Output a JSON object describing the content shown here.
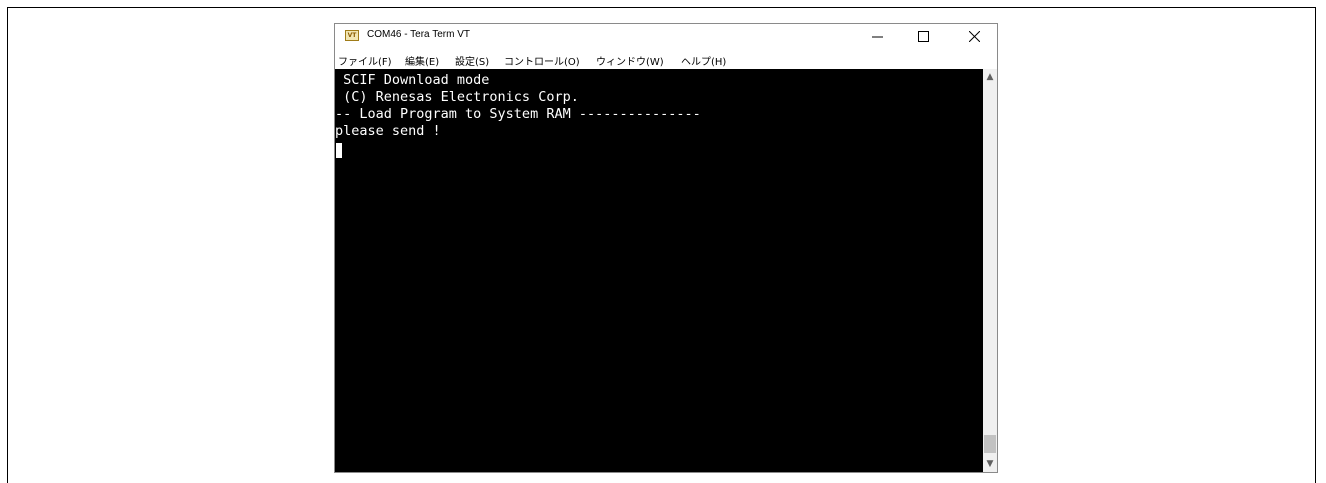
{
  "window": {
    "title": "COM46 - Tera Term VT",
    "icon_label": "VT",
    "controls": {
      "minimize": "—",
      "maximize": "☐",
      "close": "✕"
    }
  },
  "menu": [
    "ファイル(F)",
    "編集(E)",
    "設定(S)",
    "コントロール(O)",
    "ウィンドウ(W)",
    "ヘルプ(H)"
  ],
  "terminal": {
    "lines": [
      " SCIF Download mode",
      " (C) Renesas Electronics Corp.",
      "-- Load Program to System RAM ---------------",
      "please send !"
    ]
  },
  "scrollbar": {
    "up": "▲",
    "down": "▼"
  }
}
